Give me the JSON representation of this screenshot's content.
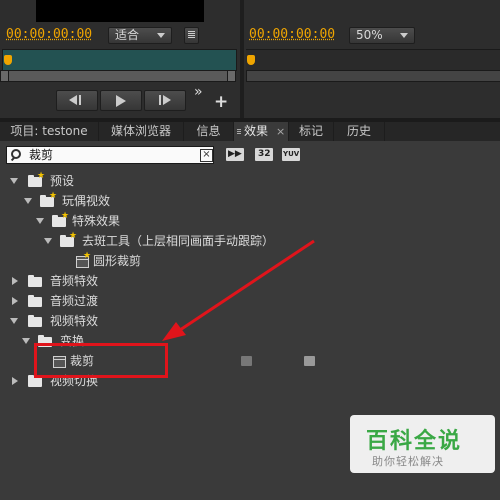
{
  "monitors": {
    "source_timecode": "00:00:00:00",
    "zoom_fit": "适合",
    "program_timecode": "00:00:00:00",
    "program_zoom": "50%",
    "more_glyph": "»",
    "add_glyph": "+"
  },
  "tabs": [
    {
      "label": "项目: testone"
    },
    {
      "label": "媒体浏览器"
    },
    {
      "label": "信息"
    },
    {
      "label": "效果"
    },
    {
      "label": "标记"
    },
    {
      "label": "历史"
    }
  ],
  "search": {
    "value": "裁剪",
    "clear_glyph": "×"
  },
  "toolbar": {
    "badge_32": "32",
    "badge_yuv": "YUV"
  },
  "tree": [
    {
      "label": "预设"
    },
    {
      "label": "玩偶视效"
    },
    {
      "label": "特殊效果"
    },
    {
      "label": "去斑工具（上层相同画面手动跟踪）"
    },
    {
      "label": "圆形裁剪"
    },
    {
      "label": "音频特效"
    },
    {
      "label": "音频过渡"
    },
    {
      "label": "视频特效"
    },
    {
      "label": "变换"
    },
    {
      "label": "裁剪"
    },
    {
      "label": "视频切换"
    }
  ],
  "watermark": {
    "title": "百科全说",
    "subtitle": "助你轻松解决"
  },
  "colors": {
    "timecode": "#f0a500",
    "annotation": "#e0141b",
    "active_tab": "#3a3a3a",
    "watermark": "#3aa845"
  }
}
